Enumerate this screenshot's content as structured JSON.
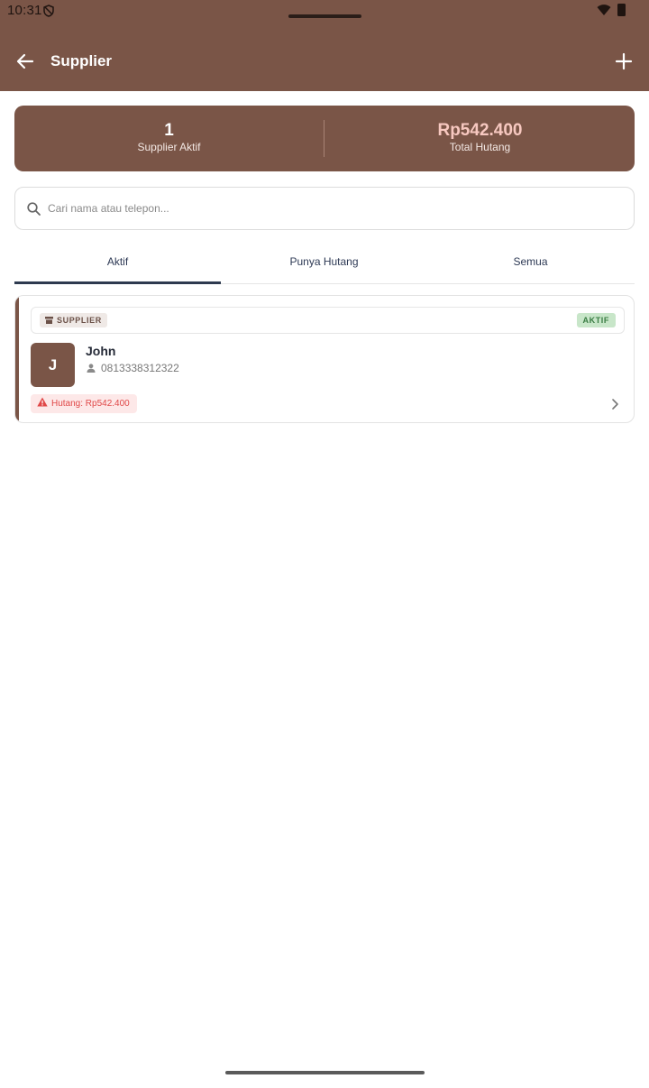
{
  "status_bar": {
    "time": "10:31"
  },
  "header": {
    "title": "Supplier"
  },
  "summary": {
    "active_count": "1",
    "active_label": "Supplier Aktif",
    "total_debt": "Rp542.400",
    "total_debt_label": "Total Hutang"
  },
  "search": {
    "placeholder": "Cari nama atau telepon..."
  },
  "tabs": [
    {
      "label": "Aktif",
      "selected": true
    },
    {
      "label": "Punya Hutang",
      "selected": false
    },
    {
      "label": "Semua",
      "selected": false
    }
  ],
  "suppliers": [
    {
      "type_badge": "SUPPLIER",
      "status_badge": "AKTIF",
      "initial": "J",
      "name": "John",
      "phone": "0813338312322",
      "debt": "Hutang: Rp542.400"
    }
  ],
  "colors": {
    "primary": "#7a5547",
    "debt_text": "#e04848",
    "active_badge_bg": "#c8e6c9",
    "active_badge_text": "#3a7d44",
    "tab_indicator": "#2e3a4f"
  },
  "icons": [
    "shield-icon",
    "wifi-icon",
    "battery-icon",
    "back-arrow-icon",
    "add-icon",
    "search-icon",
    "store-icon",
    "person-icon",
    "warning-icon",
    "chevron-right-icon"
  ]
}
